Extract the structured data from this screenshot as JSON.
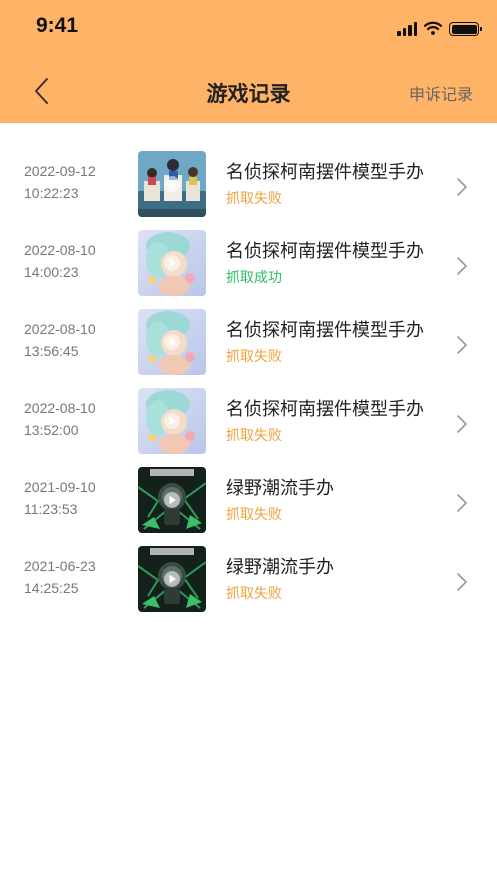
{
  "status_bar": {
    "time": "9:41",
    "icons": [
      "signal-icon",
      "wifi-icon",
      "battery-icon"
    ]
  },
  "nav": {
    "title": "游戏记录",
    "back_icon": "chevron-left-icon",
    "right_action": "申诉记录"
  },
  "colors": {
    "header_bg": "#FFB366",
    "fail": "#F0A23B",
    "success": "#2DBE60",
    "text": "#222222",
    "muted": "#777777"
  },
  "records": [
    {
      "date": "2022-09-12",
      "time": "10:22:23",
      "title": "名侦探柯南摆件模型手办",
      "result": "抓取失败",
      "status": "fail",
      "thumb": "conan"
    },
    {
      "date": "2022-08-10",
      "time": "14:00:23",
      "title": "名侦探柯南摆件模型手办",
      "result": "抓取成功",
      "status": "success",
      "thumb": "doll"
    },
    {
      "date": "2022-08-10",
      "time": "13:56:45",
      "title": "名侦探柯南摆件模型手办",
      "result": "抓取失败",
      "status": "fail",
      "thumb": "doll"
    },
    {
      "date": "2022-08-10",
      "time": "13:52:00",
      "title": "名侦探柯南摆件模型手办",
      "result": "抓取失败",
      "status": "fail",
      "thumb": "doll"
    },
    {
      "date": "2021-09-10",
      "time": "11:23:53",
      "title": "绿野潮流手办",
      "result": "抓取失败",
      "status": "fail",
      "thumb": "green"
    },
    {
      "date": "2021-06-23",
      "time": "14:25:25",
      "title": "绿野潮流手办",
      "result": "抓取失败",
      "status": "fail",
      "thumb": "green"
    }
  ]
}
